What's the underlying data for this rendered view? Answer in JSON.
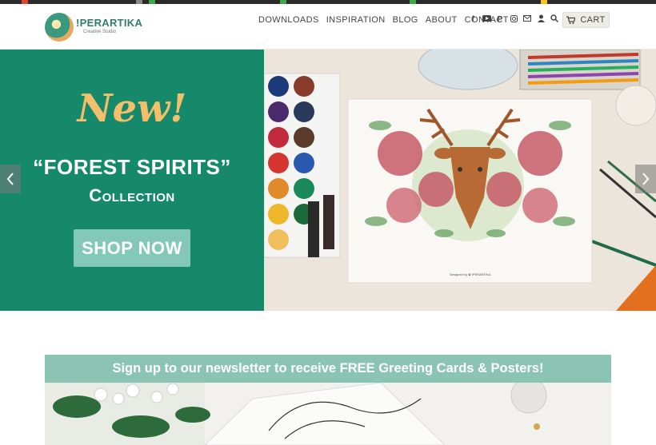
{
  "site": {
    "logo_text": "!PERARTIKA",
    "logo_sub": "Creative Studio"
  },
  "nav": {
    "items": [
      {
        "label": "DOWNLOADS"
      },
      {
        "label": "INSPIRATION"
      },
      {
        "label": "BLOG"
      },
      {
        "label": "ABOUT"
      },
      {
        "label": "CONTACT"
      }
    ],
    "social_icons": [
      "facebook-icon",
      "youtube-icon",
      "pinterest-icon",
      "instagram-icon",
      "email-icon",
      "user-icon",
      "search-icon"
    ],
    "cart_label": "CART"
  },
  "hero": {
    "headline": "New!",
    "title": "“FOREST SPIRITS”",
    "subtitle": "Collection",
    "cta": "SHOP NOW",
    "artwork_caption": "Designed by ✿ IPERARTIKA"
  },
  "newsletter": {
    "text": "Sign up to our newsletter to receive FREE Greeting Cards & Posters!"
  },
  "colors": {
    "brand_green": "#17896b",
    "accent_yellow": "#f3bf6a",
    "button_mint": "#84c8b8",
    "newsletter_band": "#8cc4b4"
  }
}
